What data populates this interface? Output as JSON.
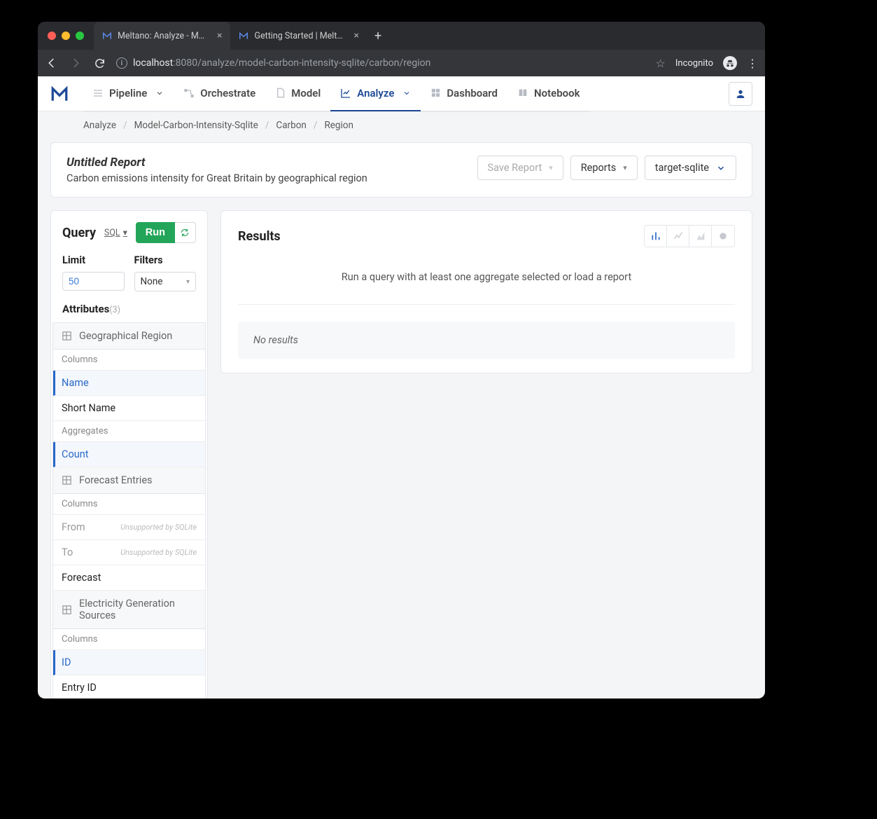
{
  "browser": {
    "tabs": [
      {
        "title": "Meltano: Analyze - Model Desi",
        "active": true
      },
      {
        "title": "Getting Started | Meltano",
        "active": false
      }
    ],
    "url_host": "localhost",
    "url_path": ":8080/analyze/model-carbon-intensity-sqlite/carbon/region",
    "incognito_label": "Incognito"
  },
  "nav": {
    "items": [
      {
        "label": "Pipeline",
        "caret": true
      },
      {
        "label": "Orchestrate"
      },
      {
        "label": "Model"
      },
      {
        "label": "Analyze",
        "caret": true,
        "active": true
      },
      {
        "label": "Dashboard"
      },
      {
        "label": "Notebook"
      }
    ]
  },
  "breadcrumbs": {
    "items": [
      "Analyze",
      "Model-Carbon-Intensity-Sqlite",
      "Carbon",
      "Region"
    ]
  },
  "report": {
    "title": "Untitled Report",
    "subtitle": "Carbon emissions intensity for Great Britain by geographical region",
    "save_label": "Save Report",
    "reports_label": "Reports",
    "target_label": "target-sqlite"
  },
  "query": {
    "title": "Query",
    "sql_label": "SQL",
    "run_label": "Run",
    "limit_label": "Limit",
    "limit_value": "50",
    "filters_label": "Filters",
    "filters_value": "None",
    "attributes_label": "Attributes",
    "attributes_count": "(3)",
    "unsupported_note": "Unsupported by SQLite",
    "columns_label": "Columns",
    "aggregates_label": "Aggregates",
    "groups": [
      {
        "name": "Geographical Region",
        "columns": [
          {
            "label": "Name",
            "selected": true
          },
          {
            "label": "Short Name"
          }
        ],
        "aggregates": [
          {
            "label": "Count",
            "selected": true
          }
        ]
      },
      {
        "name": "Forecast Entries",
        "columns": [
          {
            "label": "From",
            "unsupported": true
          },
          {
            "label": "To",
            "unsupported": true
          },
          {
            "label": "Forecast"
          }
        ]
      },
      {
        "name": "Electricity Generation Sources",
        "columns": [
          {
            "label": "ID",
            "selected": true
          },
          {
            "label": "Entry ID"
          }
        ]
      }
    ]
  },
  "results": {
    "title": "Results",
    "message": "Run a query with at least one aggregate selected or load a report",
    "no_results": "No results"
  }
}
